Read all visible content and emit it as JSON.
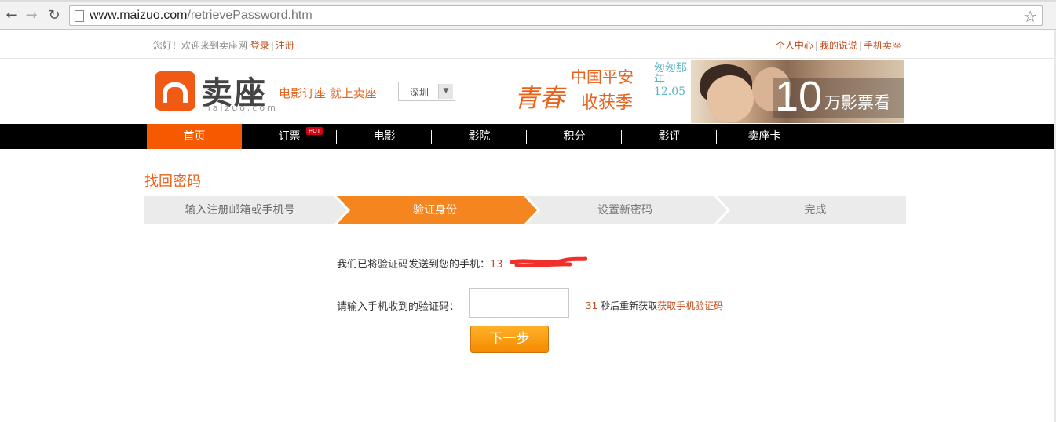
{
  "browser": {
    "url_host": "www.maizuo.com",
    "url_path": "/retrievePassword.htm"
  },
  "topbar": {
    "welcome": "您好！欢迎来到卖座网",
    "login": "登录",
    "register": "注册",
    "links": [
      "个人中心",
      "我的说说",
      "手机卖座"
    ]
  },
  "header": {
    "logo_text": "卖座",
    "logo_sub": "maizuo.com",
    "slogan": "电影订座 就上卖座",
    "city": "深圳"
  },
  "banner": {
    "top": "中国平安",
    "main": "青春",
    "small": "收获季",
    "side": "匆匆那年 12.05",
    "number": "10",
    "text": "万影票看"
  },
  "nav": {
    "items": [
      "首页",
      "订票",
      "电影",
      "影院",
      "积分",
      "影评",
      "卖座卡"
    ],
    "hot_badge": "HOT"
  },
  "content": {
    "title": "找回密码",
    "steps": [
      "输入注册邮箱或手机号",
      "验证身份",
      "设置新密码",
      "完成"
    ],
    "sent_text": "我们已将验证码发送到您的手机：",
    "phone_prefix": "13",
    "code_label": "请输入手机收到的验证码：",
    "code_value": "",
    "countdown": "31",
    "countdown_text": "秒后重新获取",
    "resend_link": "获取手机验证码",
    "next_button": "下一步"
  },
  "colors": {
    "accent": "#f55a00",
    "step_active": "#f5861f",
    "step_inactive": "#ebebeb",
    "link": "#c14a1a"
  }
}
